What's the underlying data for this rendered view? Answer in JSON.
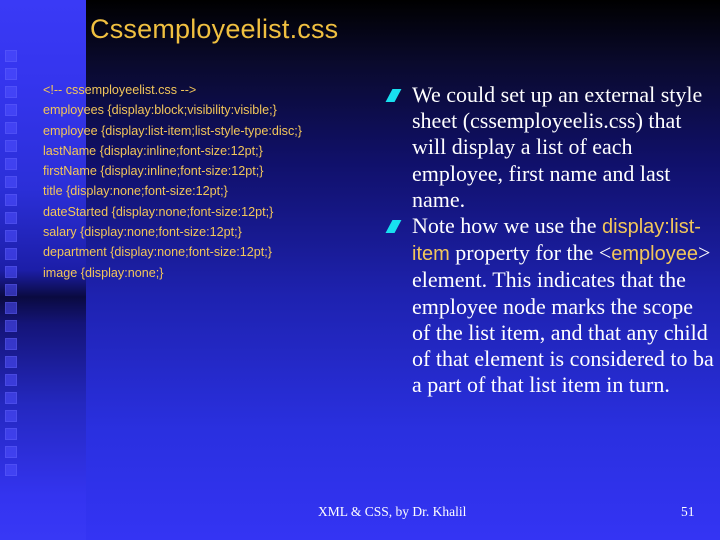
{
  "slide": {
    "title": "Cssemployeelist.css",
    "code_lines": [
      "<!-- cssemployeelist.css -->",
      "employees {display:block;visibility:visible;}",
      "employee {display:list-item;list-style-type:disc;}",
      "lastName {display:inline;font-size:12pt;}",
      "firstName {display:inline;font-size:12pt;}",
      "title {display:none;font-size:12pt;}",
      "dateStarted {display:none;font-size:12pt;}",
      "salary {display:none;font-size:12pt;}",
      "department {display:none;font-size:12pt;}",
      "image {display:none;}"
    ],
    "bullets": [
      {
        "text": "We could set up an external style sheet (cssemployeelis.css) that will display a list of each employee, first name and last name."
      },
      {
        "text_before": "Note how we use the ",
        "code1": "display:list-item",
        "text_middle": " property for the <",
        "code2": "employee",
        "text_after": "> element. This indicates that the employee node marks the scope of the list item, and that any child of that element is considered to ba a part of that list item in turn."
      }
    ],
    "footer": "XML & CSS, by Dr. Khalil",
    "page_number": "51"
  },
  "colors": {
    "title": "#f0c040",
    "code": "#f2c65a",
    "bullet_mark": "#18e0f0",
    "body_text": "#ffffff"
  }
}
